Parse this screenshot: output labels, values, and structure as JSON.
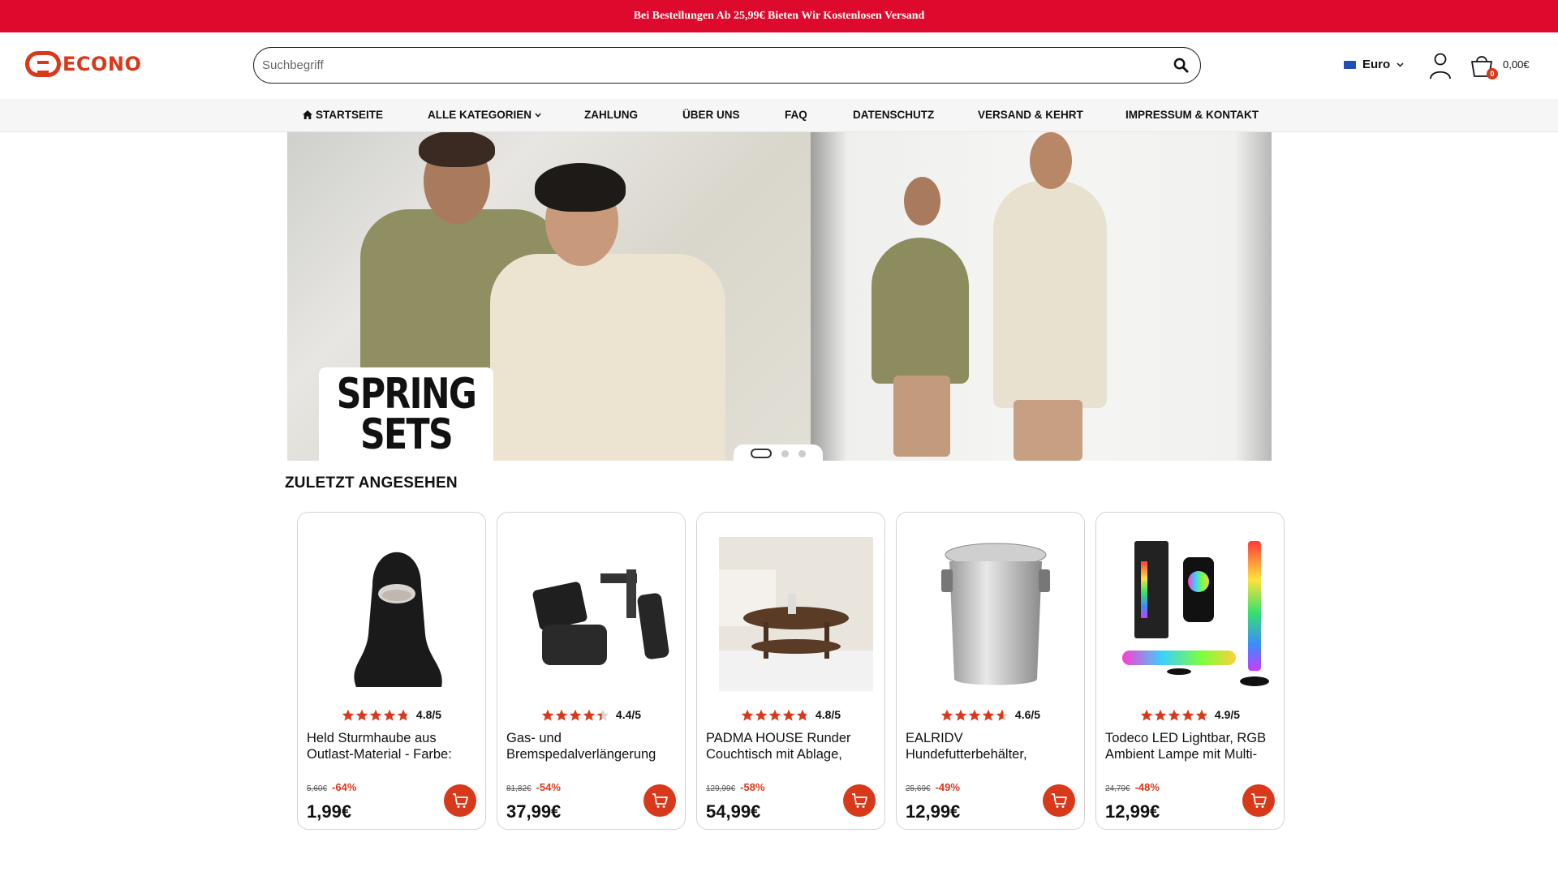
{
  "promo_banner": "Bei Bestellungen Ab 25,99€ Bieten Wir Kostenlosen Versand",
  "logo": {
    "text": "ECONO"
  },
  "search": {
    "placeholder": "Suchbegriff"
  },
  "currency": {
    "label": "Euro"
  },
  "cart": {
    "count": "0",
    "total": "0,00€"
  },
  "nav": {
    "items": [
      {
        "label": "Startseite",
        "icon": "home-icon"
      },
      {
        "label": "Alle Kategorien",
        "icon": "chevron-down-icon"
      },
      {
        "label": "Zahlung"
      },
      {
        "label": "Über uns"
      },
      {
        "label": "FAQ"
      },
      {
        "label": "Datenschutz"
      },
      {
        "label": "Versand & Kehrt"
      },
      {
        "label": "Impressum & Kontakt"
      }
    ]
  },
  "hero": {
    "slide_text_line1": "SPRING",
    "slide_text_line2": "SETS",
    "slide_count": 3,
    "active_slide": 1
  },
  "recently_viewed": {
    "title": "Zuletzt angesehen",
    "products": [
      {
        "title": "Held Sturmhaube aus Outlast-Material - Farbe:",
        "rating": "4.8/5",
        "rating_value": 4.8,
        "old_price": "5,60€",
        "discount": "-64%",
        "price": "1,99€",
        "image": "balaclava"
      },
      {
        "title": "Gas- und Bremspedalverlängerung",
        "rating": "4.4/5",
        "rating_value": 4.4,
        "old_price": "81,82€",
        "discount": "-54%",
        "price": "37,99€",
        "image": "pedal-extension"
      },
      {
        "title": "PADMA HOUSE Runder Couchtisch mit Ablage,",
        "rating": "4.8/5",
        "rating_value": 4.8,
        "old_price": "129,99€",
        "discount": "-58%",
        "price": "54,99€",
        "image": "coffee-table"
      },
      {
        "title": "EALRIDV Hundefutterbehälter,",
        "rating": "4.6/5",
        "rating_value": 4.6,
        "old_price": "25,69€",
        "discount": "-49%",
        "price": "12,99€",
        "image": "food-container"
      },
      {
        "title": "Todeco LED Lightbar, RGB Ambient Lampe mit Multi-",
        "rating": "4.9/5",
        "rating_value": 4.9,
        "old_price": "24,79€",
        "discount": "-48%",
        "price": "12,99€",
        "image": "led-lightbar"
      }
    ]
  },
  "colors": {
    "brand_red": "#dd0a2d",
    "accent_orange": "#d8391b"
  }
}
